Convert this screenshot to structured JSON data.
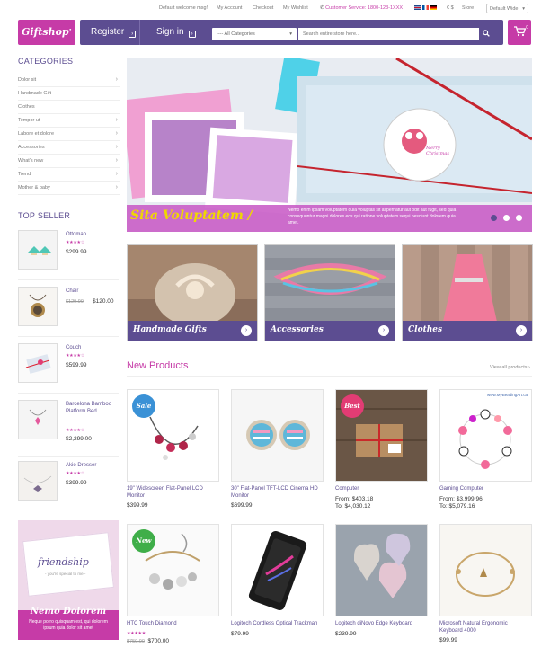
{
  "topbar": {
    "welcome": "Default welcome msg!",
    "my_account": "My Account",
    "checkout": "Checkout",
    "my_wishlist": "My Wishlist",
    "customer_service": "Customer Service: 1800-123-1XXX",
    "currency_symbols": "€ $",
    "store_label": "Store",
    "store_select": "Default Wide"
  },
  "header": {
    "logo_text": "Giftshop",
    "register": "Register",
    "sign_in": "Sign in",
    "category_select": "---- All Categories",
    "search_placeholder": "Search entire store here...",
    "cart_count": "0",
    "brand_color": "#c63ba7",
    "nav_color": "#5c4d91"
  },
  "sidebar": {
    "categories_title": "CATEGORIES",
    "categories": [
      {
        "label": "Dolor sit"
      },
      {
        "label": "Handmade Gift"
      },
      {
        "label": "Clothes"
      },
      {
        "label": "Tempor ut"
      },
      {
        "label": "Labore et dolore"
      },
      {
        "label": "Accessories"
      },
      {
        "label": "What's new"
      },
      {
        "label": "Trend"
      },
      {
        "label": "Mother & baby"
      }
    ],
    "top_seller_title": "TOP SELLER",
    "sellers": [
      {
        "name": "Ottoman",
        "stars": "★★★★☆",
        "price": "$299.99",
        "old_price": ""
      },
      {
        "name": "Chair",
        "stars": "",
        "price": "$120.00",
        "old_price": "$129.99"
      },
      {
        "name": "Couch",
        "stars": "★★★★☆",
        "price": "$599.99",
        "old_price": ""
      },
      {
        "name": "Barcelona Bamboo Platform Bed",
        "stars": "★★★★☆",
        "price": "$2,299.00",
        "old_price": ""
      },
      {
        "name": "Akio Dresser",
        "stars": "★★★★☆",
        "price": "$399.99",
        "old_price": ""
      }
    ],
    "promo": {
      "card_text": "friendship",
      "card_sub": "- you're special to me -",
      "title": "Nemo Dolorem",
      "text": "Neque porro quisquam est, qui dolorem ipsum quia dolor sit amet"
    }
  },
  "hero": {
    "title": "Sita Voluptatem /",
    "text": "Nemo enim ipsam voluptatem quia voluptas sit aspernatur aut odit aut fugit, sed quia consequuntur magni dolores eos qui ratione voluptatem sequi nesciunt dolorem quia amet.",
    "tag_text": "Merry Christmas"
  },
  "category_banners": [
    {
      "label": "Handmade Gifts"
    },
    {
      "label": "Accessories"
    },
    {
      "label": "Clothes"
    }
  ],
  "new_products": {
    "title": "New Products",
    "view_all": "View all products",
    "items": [
      {
        "badge": "Sale",
        "name": "19\" Widescreen Flat-Panel LCD Monitor",
        "price": "$399.99"
      },
      {
        "badge": "",
        "name": "30\" Flat-Panel TFT-LCD Cinema HD Monitor",
        "price": "$699.99"
      },
      {
        "badge": "Best",
        "name": "Computer",
        "from": "From: $403.18",
        "to": "To: $4,030.12"
      },
      {
        "badge": "",
        "name": "Gaming Computer",
        "from": "From: $3,999.96",
        "to": "To: $5,079.16",
        "watermark": "www.MyBeadingArt.ca"
      },
      {
        "badge": "New",
        "name": "HTC Touch Diamond",
        "stars": "★★★★★",
        "old_price": "$750.00",
        "price": "$700.00"
      },
      {
        "badge": "",
        "name": "Logitech Cordless Optical Trackman",
        "price": "$79.99"
      },
      {
        "badge": "",
        "name": "Logitech diNovo Edge Keyboard",
        "price": "$239.99"
      },
      {
        "badge": "",
        "name": "Microsoft Natural Ergonomic Keyboard 4000",
        "price": "$99.99"
      }
    ]
  }
}
